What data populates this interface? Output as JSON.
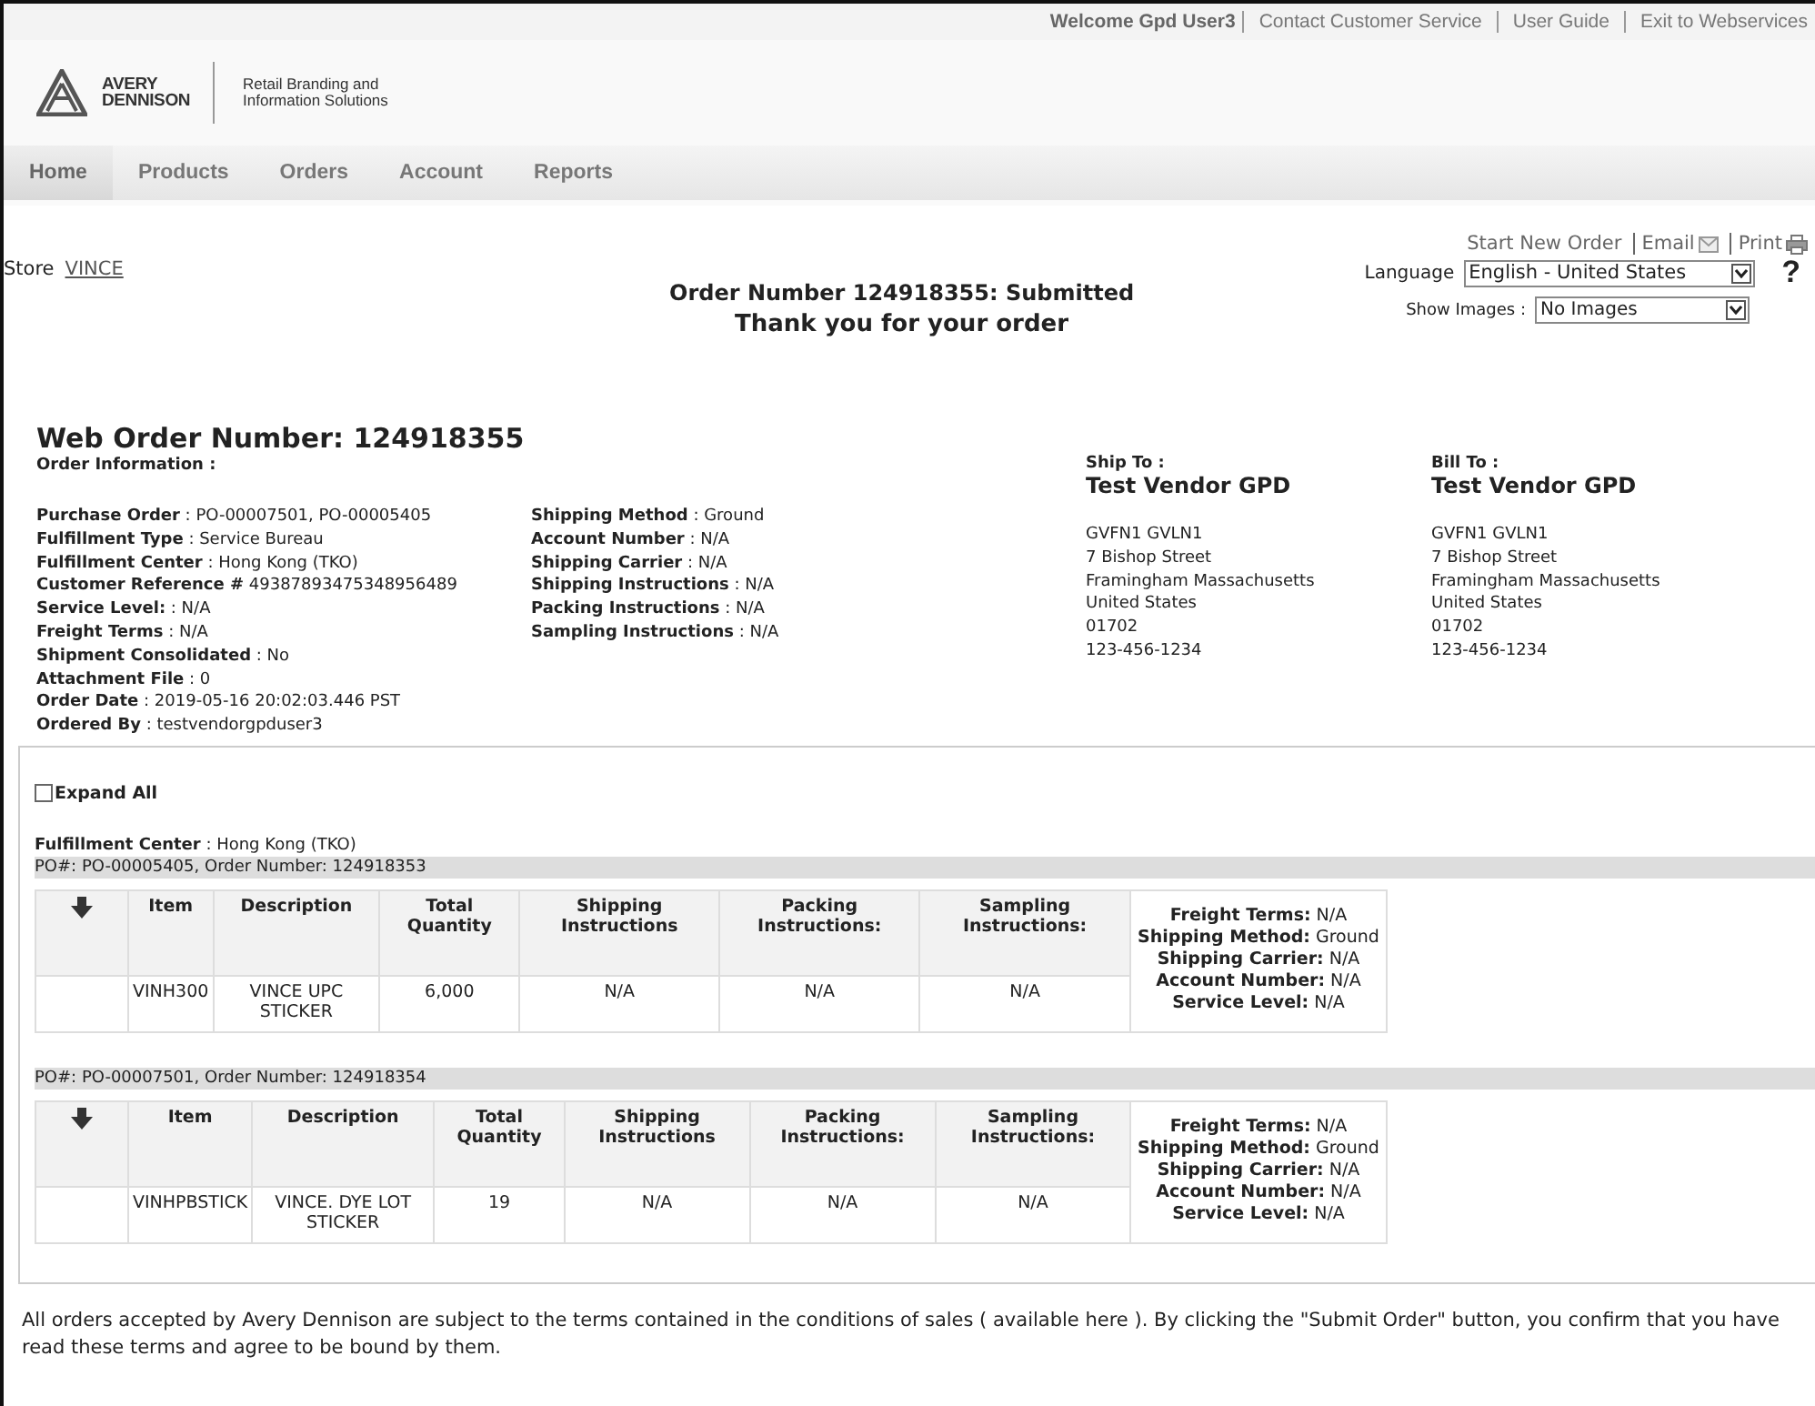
{
  "top_bar": {
    "welcome": "Welcome Gpd User3",
    "links": [
      "Contact Customer Service",
      "User Guide",
      "Exit to Webservices"
    ]
  },
  "logo": {
    "brand": [
      "AVERY",
      "DENNISON"
    ],
    "tagline": [
      "Retail Branding and",
      "Information Solutions"
    ]
  },
  "nav": [
    {
      "label": "Home",
      "selected": true
    },
    {
      "label": "Products",
      "selected": false
    },
    {
      "label": "Orders",
      "selected": false
    },
    {
      "label": "Account",
      "selected": false
    },
    {
      "label": "Reports",
      "selected": false
    }
  ],
  "actions": [
    {
      "label": "Start New Order",
      "kind": "plain"
    },
    {
      "label": "Email",
      "kind": "email"
    },
    {
      "label": "Print",
      "kind": "print"
    }
  ],
  "store": {
    "label": "Store",
    "value": "VINCE"
  },
  "heading": {
    "title": "Order Number 124918355: Submitted",
    "subtitle": "Thank you for your order"
  },
  "language": {
    "label": "Language",
    "value": "English - United States"
  },
  "show_images": {
    "label": "Show Images :",
    "value": "No Images"
  },
  "help": "?",
  "web_order": {
    "label": "Web Order Number:",
    "value": "124918355"
  },
  "order_info_title": "Order Information :",
  "info_left": [
    "**Purchase Order** : PO-00007501, PO-00005405",
    "**Fulfillment Type** : Service Bureau",
    "**Fulfillment Center** : Hong Kong (TKO)",
    "**Customer Reference #** 49387893475348956489",
    "**Service Level:** : N/A",
    "**Freight Terms** : N/A",
    "**Shipment Consolidated** : No",
    "**Attachment File** : 0",
    "**Order Date** : 2019-05-16 20:02:03.446 PST",
    "**Ordered By** : testvendorgpduser3"
  ],
  "info_middle": [
    "**Shipping Method** : Ground",
    "**Account Number** : N/A",
    "**Shipping Carrier** : N/A",
    "**Shipping Instructions** : N/A",
    "**Packing Instructions** : N/A",
    "**Sampling Instructions** : N/A"
  ],
  "addresses": [
    {
      "title": "Ship To :",
      "name": "Test Vendor GPD",
      "lines": [
        "GVFN1 GVLN1",
        "7 Bishop Street",
        "Framingham Massachusetts",
        "United States",
        "01702",
        "123-456-1234"
      ]
    },
    {
      "title": "Bill To :",
      "name": "Test Vendor GPD",
      "lines": [
        "GVFN1 GVLN1",
        "7 Bishop Street",
        "Framingham Massachusetts",
        "United States",
        "01702",
        "123-456-1234"
      ]
    }
  ],
  "expand_all": {
    "label": "Expand All",
    "checked": false
  },
  "fulfillment_center": "**Fulfillment Center** : Hong Kong (TKO)",
  "orders": [
    {
      "header": "PO#: PO-00005405, Order Number: 124918353",
      "columns": [
        "Item",
        "Description",
        "Total Quantity",
        "Shipping Instructions",
        "Packing Instructions:",
        "Sampling Instructions:"
      ],
      "cells": [
        "VINH300",
        "VINCE UPC STICKER",
        "6,000",
        "N/A",
        "N/A",
        "N/A"
      ],
      "summary": [
        "**Freight Terms:** N/A",
        "**Shipping Method:** Ground",
        "**Shipping Carrier:** N/A",
        "**Account Number:** N/A",
        "**Service Level:** N/A"
      ]
    },
    {
      "header": "PO#: PO-00007501, Order Number: 124918354",
      "columns": [
        "Item",
        "Description",
        "Total Quantity",
        "Shipping Instructions",
        "Packing Instructions:",
        "Sampling Instructions:"
      ],
      "cells": [
        "VINHPBSTICK",
        "VINCE. DYE LOT STICKER",
        "19",
        "N/A",
        "N/A",
        "N/A"
      ],
      "summary": [
        "**Freight Terms:** N/A",
        "**Shipping Method:** Ground",
        "**Shipping Carrier:** N/A",
        "**Account Number:** N/A",
        "**Service Level:** N/A"
      ]
    }
  ],
  "footer": "All orders accepted by Avery Dennison are subject to the terms contained in the conditions of sales ( available here ). By clicking the \"Submit Order\" button, you confirm that you have read these terms and agree to be bound by them."
}
